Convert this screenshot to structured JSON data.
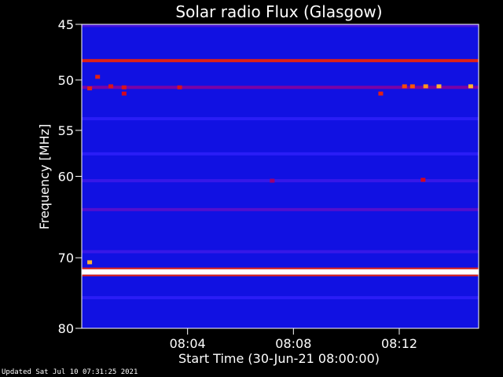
{
  "chart_data": {
    "type": "heatmap",
    "title": "Solar radio Flux (Glasgow)",
    "xlabel": "Start Time (30-Jun-21 08:00:00)",
    "ylabel": "Frequency [MHz]",
    "xlim_minutes": [
      0,
      15
    ],
    "ylim": [
      45,
      80
    ],
    "y_scale": "log",
    "y_inverted": true,
    "x_ticks": [
      {
        "value": 4,
        "label": "08:04"
      },
      {
        "value": 8,
        "label": "08:08"
      },
      {
        "value": 12,
        "label": "08:12"
      }
    ],
    "y_ticks": [
      {
        "value": 45,
        "label": "45"
      },
      {
        "value": 50,
        "label": "50"
      },
      {
        "value": 55,
        "label": "55"
      },
      {
        "value": 60,
        "label": "60"
      },
      {
        "value": 70,
        "label": "70"
      },
      {
        "value": 80,
        "label": "80"
      }
    ],
    "colormap": [
      "#000060",
      "#0000c0",
      "#2020ff",
      "#8000a0",
      "#d00020",
      "#ff6000",
      "#ffd040",
      "#ffffff"
    ],
    "background_level": 0.22,
    "bands": [
      {
        "freq_mhz": 45.1,
        "level": 0.34
      },
      {
        "freq_mhz": 48.2,
        "level": 0.62
      },
      {
        "freq_mhz": 50.7,
        "level": 0.42
      },
      {
        "freq_mhz": 53.8,
        "level": 0.3
      },
      {
        "freq_mhz": 57.5,
        "level": 0.3
      },
      {
        "freq_mhz": 60.5,
        "level": 0.32
      },
      {
        "freq_mhz": 63.9,
        "level": 0.36
      },
      {
        "freq_mhz": 69.2,
        "level": 0.32
      },
      {
        "freq_mhz": 71.9,
        "level": 1.0
      },
      {
        "freq_mhz": 75.5,
        "level": 0.3
      }
    ],
    "bursts": [
      {
        "time_min": 0.3,
        "freq_mhz": 50.8,
        "level": 0.62
      },
      {
        "time_min": 0.6,
        "freq_mhz": 49.7,
        "level": 0.62
      },
      {
        "time_min": 1.1,
        "freq_mhz": 50.6,
        "level": 0.6
      },
      {
        "time_min": 1.6,
        "freq_mhz": 50.7,
        "level": 0.6
      },
      {
        "time_min": 1.6,
        "freq_mhz": 51.3,
        "level": 0.58
      },
      {
        "time_min": 3.7,
        "freq_mhz": 50.7,
        "level": 0.6
      },
      {
        "time_min": 11.3,
        "freq_mhz": 51.3,
        "level": 0.62
      },
      {
        "time_min": 12.2,
        "freq_mhz": 50.6,
        "level": 0.68
      },
      {
        "time_min": 12.5,
        "freq_mhz": 50.6,
        "level": 0.7
      },
      {
        "time_min": 13.0,
        "freq_mhz": 50.6,
        "level": 0.78
      },
      {
        "time_min": 13.5,
        "freq_mhz": 50.6,
        "level": 0.82
      },
      {
        "time_min": 14.7,
        "freq_mhz": 50.6,
        "level": 0.82
      },
      {
        "time_min": 12.9,
        "freq_mhz": 60.4,
        "level": 0.58
      },
      {
        "time_min": 7.2,
        "freq_mhz": 60.5,
        "level": 0.48
      },
      {
        "time_min": 0.3,
        "freq_mhz": 70.6,
        "level": 0.82
      }
    ]
  },
  "footer_text": "Updated Sat Jul 10 07:31:25 2021"
}
